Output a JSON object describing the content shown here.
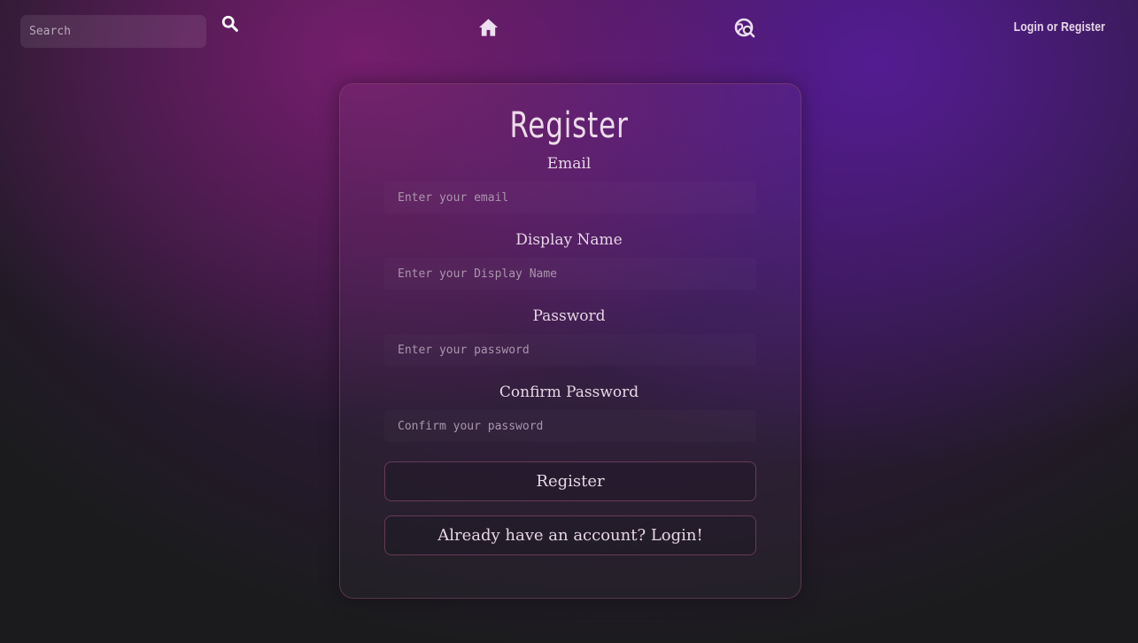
{
  "nav": {
    "search_placeholder": "Search",
    "login_label": "Login or Register",
    "icons": {
      "search": "search-icon",
      "home": "home-icon",
      "explore": "explore-icon"
    }
  },
  "form": {
    "title": "Register",
    "fields": [
      {
        "label": "Email",
        "placeholder": "Enter your email"
      },
      {
        "label": "Display Name",
        "placeholder": "Enter your Display Name"
      },
      {
        "label": "Password",
        "placeholder": "Enter your password"
      },
      {
        "label": "Confirm Password",
        "placeholder": "Confirm your password"
      }
    ],
    "submit_label": "Register",
    "login_prompt": "Already have an account? Login!"
  },
  "colors": {
    "background": "#1b1b1d",
    "magenta_glow": "#781e6e",
    "violet_glow": "#551c96",
    "text": "#e6d6e4"
  }
}
